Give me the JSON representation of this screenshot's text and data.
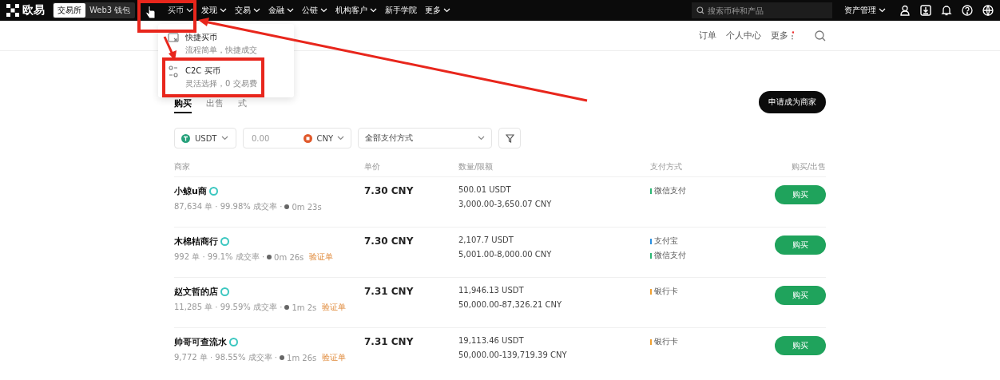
{
  "top_nav": {
    "logo": "欧易",
    "mode_toggle": [
      {
        "label": "交易所",
        "selected": true
      },
      {
        "label": "Web3 钱包",
        "selected": false
      }
    ],
    "menu": [
      {
        "label": "买币",
        "selected": true,
        "dropdown": true
      },
      {
        "label": "发现",
        "selected": false,
        "dropdown": true
      },
      {
        "label": "交易",
        "selected": false,
        "dropdown": true
      },
      {
        "label": "金融",
        "selected": false,
        "dropdown": true
      },
      {
        "label": "公链",
        "selected": false,
        "dropdown": true
      },
      {
        "label": "机构客户",
        "selected": false,
        "dropdown": true
      },
      {
        "label": "新手学院",
        "selected": false,
        "dropdown": false
      },
      {
        "label": "更多",
        "selected": false,
        "dropdown": true
      }
    ],
    "search": {
      "placeholder": "搜索币种和产品"
    },
    "assets": "资产管理"
  },
  "sub_nav": [
    "订单",
    "个人中心",
    "更多"
  ],
  "dropdown": [
    {
      "title": "快捷买币",
      "subtitle": "流程简单，快捷成交"
    },
    {
      "title": "C2C 买币",
      "subtitle": "灵活选择，0 交易费"
    }
  ],
  "tabs": [
    {
      "label": "购买",
      "selected": true
    },
    {
      "label": "出售",
      "selected": false
    },
    {
      "label": "式",
      "selected": false
    }
  ],
  "apply_button": "申请成为商家",
  "filters": {
    "crypto": "USDT",
    "amount_placeholder": "0.00",
    "fiat": "CNY",
    "payment": "全部支付方式"
  },
  "table": {
    "columns": [
      "商家",
      "单价",
      "数量/限额",
      "支付方式",
      "购买/出售"
    ],
    "rows": [
      {
        "merchant": "小鲸u商",
        "stats": "87,634 单 · 99.98% 成交率 · ",
        "time": "0m 23s",
        "tag": "",
        "price": "7.30 CNY",
        "quantity": "500.01 USDT",
        "limit": "3,000.00-3,650.07 CNY",
        "payments": [
          {
            "name": "微信支付",
            "color": "#2bb673"
          }
        ],
        "action": "购买"
      },
      {
        "merchant": "木棉桔商行",
        "stats": "992 单 · 99.1% 成交率 · ",
        "time": "0m 26s",
        "tag": "验证单",
        "price": "7.30 CNY",
        "quantity": "2,107.7 USDT",
        "limit": "5,001.00-8,000.00 CNY",
        "payments": [
          {
            "name": "支付宝",
            "color": "#2b8fe0"
          },
          {
            "name": "微信支付",
            "color": "#2bb673"
          }
        ],
        "action": "购买"
      },
      {
        "merchant": "赵文哲的店",
        "stats": "11,285 单 · 99.59% 成交率 · ",
        "time": "1m 2s",
        "tag": "验证单",
        "price": "7.31 CNY",
        "quantity": "11,946.13 USDT",
        "limit": "50,000.00-87,326.21 CNY",
        "payments": [
          {
            "name": "银行卡",
            "color": "#f0a030"
          }
        ],
        "action": "购买"
      },
      {
        "merchant": "帅哥可查流水",
        "stats": "9,772 单 · 98.55% 成交率 · ",
        "time": "1m 26s",
        "tag": "验证单",
        "price": "7.31 CNY",
        "quantity": "19,113.46 USDT",
        "limit": "50,000.00-139,719.39 CNY",
        "payments": [
          {
            "name": "银行卡",
            "color": "#f0a030"
          }
        ],
        "action": "购买"
      }
    ]
  }
}
